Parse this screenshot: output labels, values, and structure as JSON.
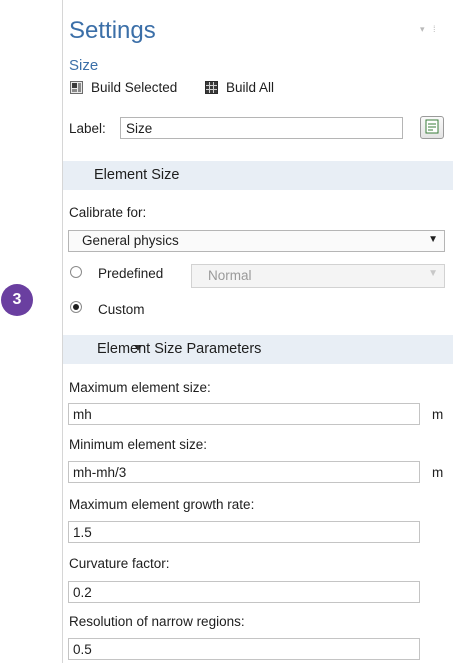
{
  "header": {
    "title": "Settings",
    "subtitle": "Size",
    "build_selected": "Build Selected",
    "build_all": "Build All"
  },
  "label_row": {
    "label": "Label:",
    "value": "Size"
  },
  "sections": {
    "element_size": "Element Size",
    "element_size_parameters": "Element Size Parameters"
  },
  "calibrate": {
    "label": "Calibrate for:",
    "selected": "General physics"
  },
  "radios": {
    "predefined": {
      "label": "Predefined",
      "checked": false,
      "select_value": "Normal"
    },
    "custom": {
      "label": "Custom",
      "checked": true
    }
  },
  "callout": {
    "number": "3",
    "color": "#6a3fa0"
  },
  "params": {
    "max_size": {
      "label": "Maximum element size:",
      "value": "mh",
      "unit": "m"
    },
    "min_size": {
      "label": "Minimum element size:",
      "value": "mh-mh/3",
      "unit": "m"
    },
    "growth_rate": {
      "label": "Maximum element growth rate:",
      "value": "1.5"
    },
    "curvature": {
      "label": "Curvature factor:",
      "value": "0.2"
    },
    "narrow": {
      "label": "Resolution of narrow regions:",
      "value": "0.5"
    }
  },
  "colors": {
    "accent": "#3b6fa8",
    "section_bg": "#e8eef5"
  },
  "icons": [
    "build-selected-icon",
    "build-all-icon",
    "label-edit-icon",
    "pin-icon",
    "collapse-triangle-icon",
    "dropdown-arrow-icon"
  ]
}
